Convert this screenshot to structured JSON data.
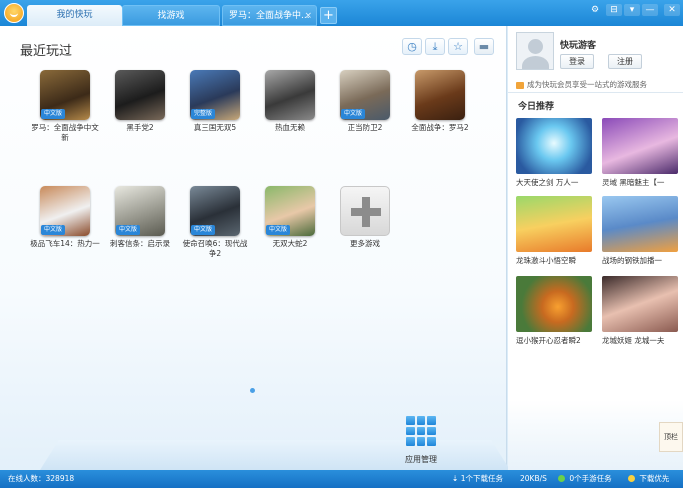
{
  "tabs": [
    {
      "label": "我的快玩"
    },
    {
      "label": "找游戏"
    },
    {
      "label": "罗马：全面战争中...",
      "close": "×"
    }
  ],
  "tab_add": "+",
  "window_controls": [
    "⚙",
    "⊟",
    "▾",
    "—",
    "□",
    "✕"
  ],
  "main": {
    "title": "最近玩过",
    "tools": [
      "◷",
      "⤓",
      "☆",
      "🗑"
    ],
    "games": [
      {
        "name": "罗马：全面战争中文新",
        "badge": "中文版"
      },
      {
        "name": "黑手党2",
        "badge": ""
      },
      {
        "name": "真三国无双5",
        "badge": "完整版"
      },
      {
        "name": "热血无赖",
        "badge": ""
      },
      {
        "name": "正当防卫2",
        "badge": "中文版"
      },
      {
        "name": "全面战争：罗马2",
        "badge": ""
      },
      {
        "name": "极品飞车14：热力一",
        "badge": "中文版"
      },
      {
        "name": "刺客信条：启示录",
        "badge": "中文版"
      },
      {
        "name": "使命召唤6：现代战争2",
        "badge": "中文版"
      },
      {
        "name": "无双大蛇2",
        "badge": "中文版"
      },
      {
        "name": "更多游戏",
        "badge": ""
      }
    ],
    "app_manager": "应用管理"
  },
  "sidebar": {
    "guest": "快玩游客",
    "login": "登录",
    "register": "注册",
    "promo": "成为快玩会员享受一站式的游戏服务",
    "rec_title": "今日推荐",
    "recommendations": [
      {
        "caption": "大天使之剑 万人一"
      },
      {
        "caption": "灵域 黑暗魅主【一"
      },
      {
        "caption": "龙珠激斗小悟空瞬"
      },
      {
        "caption": "战场的钢铁加播一"
      },
      {
        "caption": "逗小猴开心忍者瞬2"
      },
      {
        "caption": "龙城妖姬 龙城一夫"
      }
    ],
    "side_tab": "顶栏"
  },
  "status": {
    "online": "在线人数：328918",
    "downloads": "1个下载任务",
    "speed": "20KB/S",
    "mobile": "0个手游任务",
    "priority": "下载优先"
  },
  "colors": {
    "titlebar": "#1b86d6",
    "accent": "#2a86d8",
    "statusbar": "#1570c4"
  }
}
